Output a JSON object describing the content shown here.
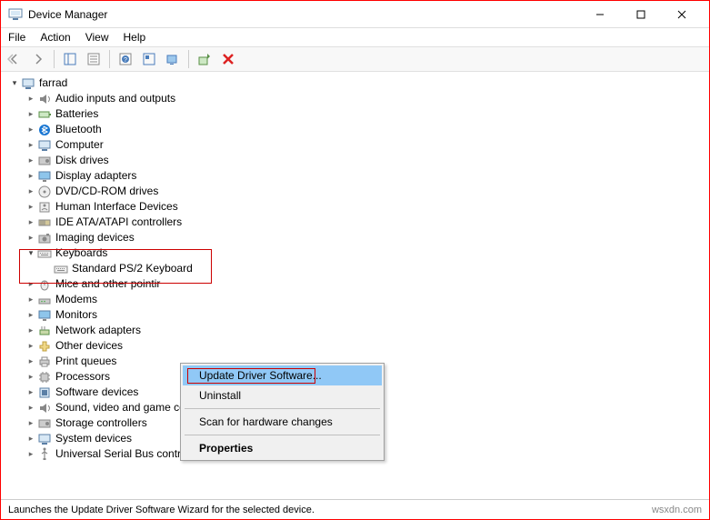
{
  "window": {
    "title": "Device Manager"
  },
  "menu": {
    "file": "File",
    "action": "Action",
    "view": "View",
    "help": "Help"
  },
  "tree": {
    "root": "farrad",
    "items": [
      "Audio inputs and outputs",
      "Batteries",
      "Bluetooth",
      "Computer",
      "Disk drives",
      "Display adapters",
      "DVD/CD-ROM drives",
      "Human Interface Devices",
      "IDE ATA/ATAPI controllers",
      "Imaging devices",
      "Keyboards",
      "Mice and other pointir",
      "Modems",
      "Monitors",
      "Network adapters",
      "Other devices",
      "Print queues",
      "Processors",
      "Software devices",
      "Sound, video and game controllers",
      "Storage controllers",
      "System devices",
      "Universal Serial Bus controllers"
    ],
    "keyboard_child": "Standard PS/2 Keyboard"
  },
  "context": {
    "update": "Update Driver Software...",
    "uninstall": "Uninstall",
    "scan": "Scan for hardware changes",
    "properties": "Properties"
  },
  "status": {
    "text": "Launches the Update Driver Software Wizard for the selected device.",
    "watermark": "wsxdn.com"
  }
}
